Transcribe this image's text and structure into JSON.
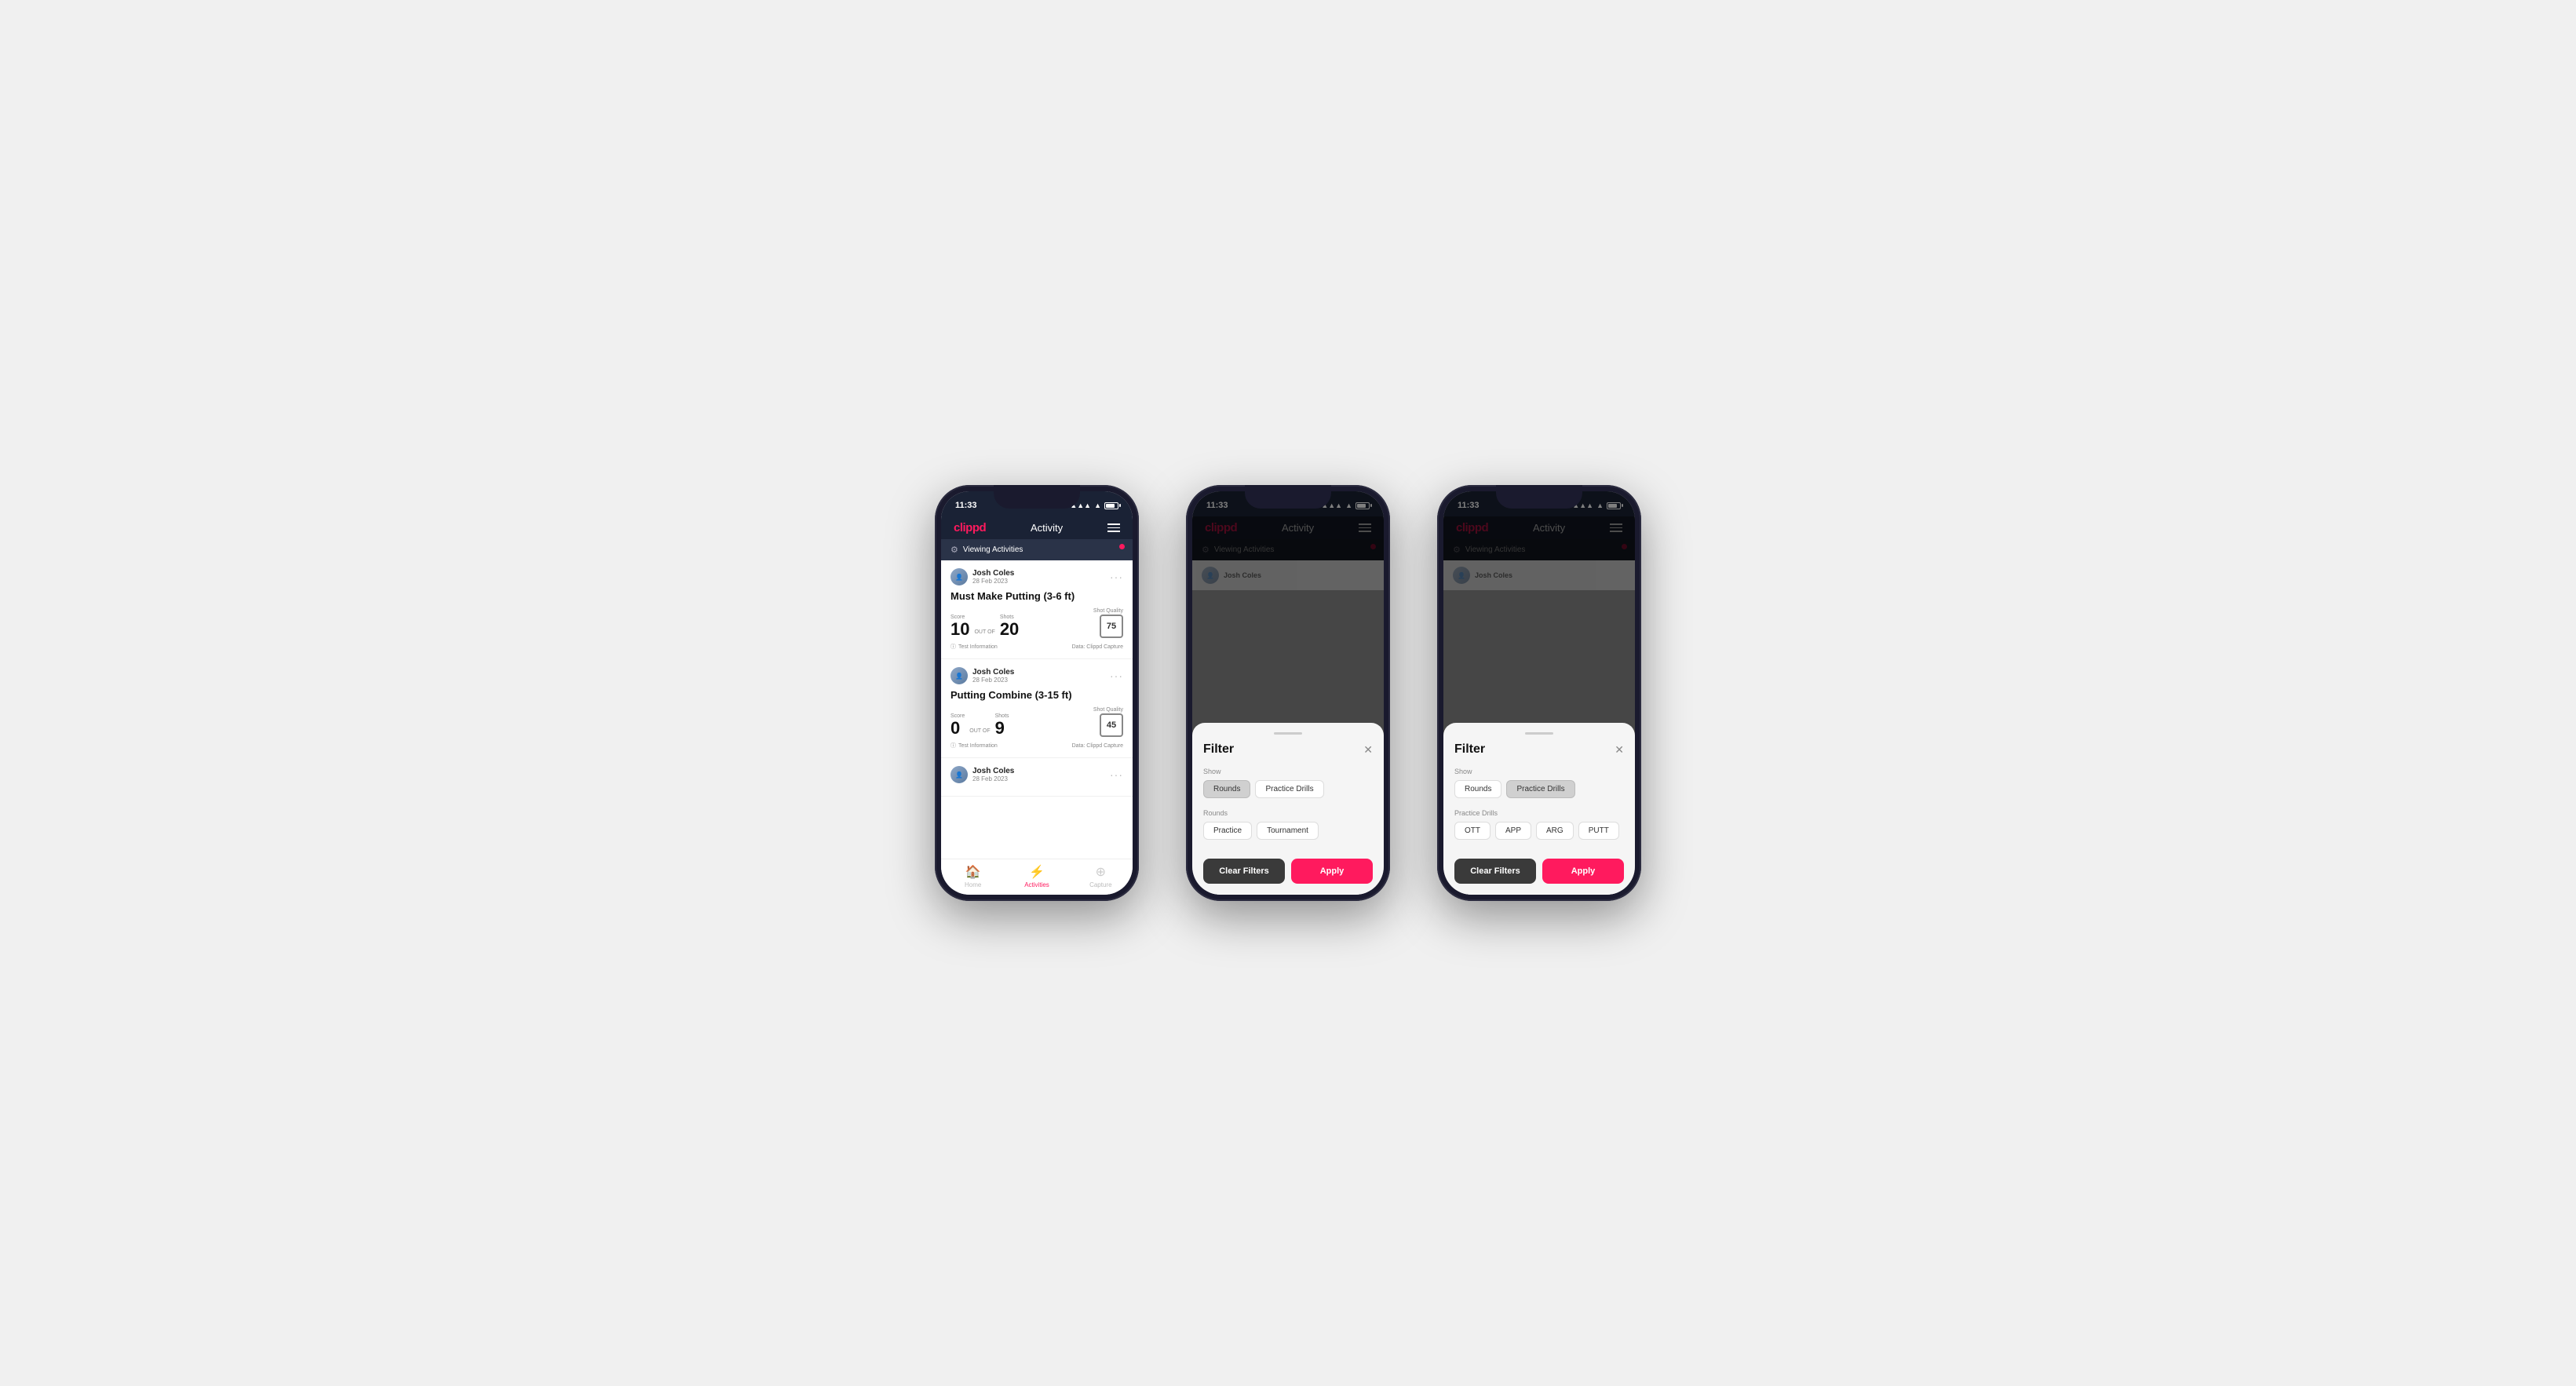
{
  "app": {
    "logo": "clippd",
    "nav_title": "Activity",
    "status_time": "11:33",
    "viewing_banner": "Viewing Activities"
  },
  "phone1": {
    "activities": [
      {
        "user_name": "Josh Coles",
        "user_date": "28 Feb 2023",
        "title": "Must Make Putting (3-6 ft)",
        "score_label": "Score",
        "score_value": "10",
        "out_of_text": "OUT OF",
        "shots_label": "Shots",
        "shots_value": "20",
        "shot_quality_label": "Shot Quality",
        "shot_quality_value": "75",
        "test_info": "Test Information",
        "data_source": "Data: Clippd Capture"
      },
      {
        "user_name": "Josh Coles",
        "user_date": "28 Feb 2023",
        "title": "Putting Combine (3-15 ft)",
        "score_label": "Score",
        "score_value": "0",
        "out_of_text": "OUT OF",
        "shots_label": "Shots",
        "shots_value": "9",
        "shot_quality_label": "Shot Quality",
        "shot_quality_value": "45",
        "test_info": "Test Information",
        "data_source": "Data: Clippd Capture"
      },
      {
        "user_name": "Josh Coles",
        "user_date": "28 Feb 2023",
        "title": "",
        "score_label": "",
        "score_value": "",
        "out_of_text": "",
        "shots_label": "",
        "shots_value": "",
        "shot_quality_label": "",
        "shot_quality_value": "",
        "test_info": "",
        "data_source": ""
      }
    ],
    "tabs": [
      {
        "label": "Home",
        "icon": "🏠",
        "active": false
      },
      {
        "label": "Activities",
        "icon": "⚡",
        "active": true
      },
      {
        "label": "Capture",
        "icon": "➕",
        "active": false
      }
    ]
  },
  "phone2": {
    "filter": {
      "title": "Filter",
      "show_label": "Show",
      "show_buttons": [
        {
          "label": "Rounds",
          "active": true
        },
        {
          "label": "Practice Drills",
          "active": false
        }
      ],
      "rounds_label": "Rounds",
      "round_buttons": [
        {
          "label": "Practice",
          "active": false
        },
        {
          "label": "Tournament",
          "active": false
        }
      ],
      "clear_label": "Clear Filters",
      "apply_label": "Apply"
    }
  },
  "phone3": {
    "filter": {
      "title": "Filter",
      "show_label": "Show",
      "show_buttons": [
        {
          "label": "Rounds",
          "active": false
        },
        {
          "label": "Practice Drills",
          "active": true
        }
      ],
      "drills_label": "Practice Drills",
      "drill_buttons": [
        {
          "label": "OTT",
          "active": false
        },
        {
          "label": "APP",
          "active": false
        },
        {
          "label": "ARG",
          "active": false
        },
        {
          "label": "PUTT",
          "active": false
        }
      ],
      "clear_label": "Clear Filters",
      "apply_label": "Apply"
    }
  }
}
